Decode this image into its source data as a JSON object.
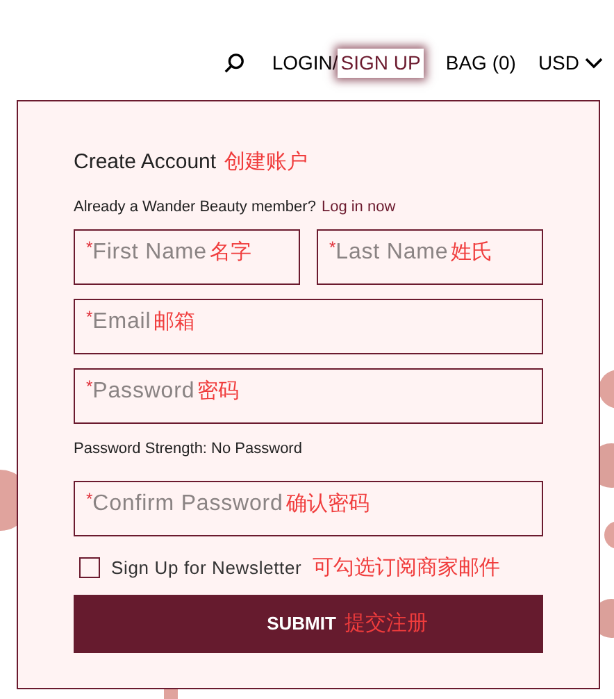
{
  "nav": {
    "login": "LOGIN",
    "separator": "/",
    "items": [
      {
        "label": "SIGN UP",
        "selected": true
      },
      {
        "label": "BAG (0)",
        "selected": false
      }
    ],
    "currency": "USD"
  },
  "form": {
    "title": "Create Account",
    "title_note": "创建账户",
    "member_text": "Already a Wander Beauty member?",
    "login_link": "Log in now",
    "name_fields": [
      {
        "mark": "*",
        "placeholder": "First Name",
        "note": "名字"
      },
      {
        "mark": "*",
        "placeholder": "Last Name",
        "note": "姓氏"
      }
    ],
    "fields": [
      {
        "mark": "*",
        "placeholder": "Email",
        "note": "邮箱"
      },
      {
        "mark": "*",
        "placeholder": "Password",
        "note": "密码"
      }
    ],
    "strength": "Password Strength: No Password",
    "confirm": {
      "mark": "*",
      "placeholder": "Confirm Password",
      "note": "确认密码"
    },
    "newsletter": {
      "checked": false,
      "label": "Sign Up for Newsletter",
      "note": "可勾选订阅商家邮件"
    },
    "submit": {
      "label": "SUBMIT",
      "note": "提交注册"
    }
  }
}
